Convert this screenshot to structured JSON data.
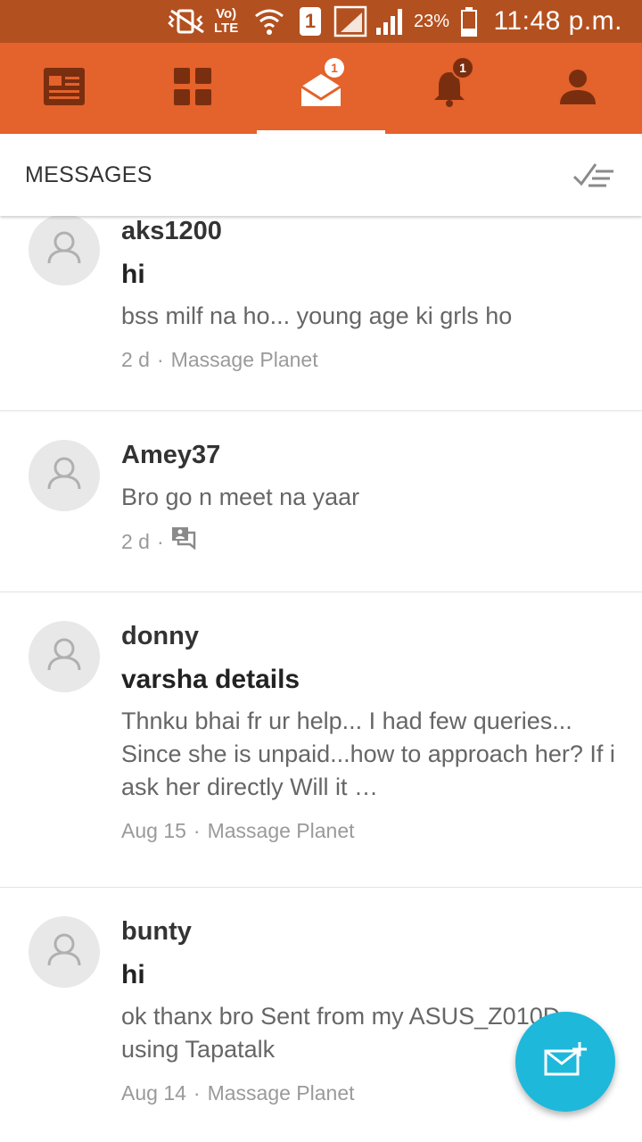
{
  "status_bar": {
    "network_label_top": "Vo)",
    "network_label_bottom": "LTE",
    "sim_slot": "1",
    "battery_percent": "23%",
    "time": "11:48 p.m.",
    "icons": [
      "vibrate-icon",
      "volte-icon",
      "wifi-icon",
      "sim-icon",
      "signal-icon",
      "signal-icon",
      "battery-icon"
    ]
  },
  "nav": {
    "tabs": [
      {
        "name": "topics",
        "icon": "newspaper-icon"
      },
      {
        "name": "forums",
        "icon": "grid-icon"
      },
      {
        "name": "messages",
        "icon": "mail-icon",
        "badge": "1",
        "active": true
      },
      {
        "name": "notifications",
        "icon": "bell-icon",
        "badge": "1"
      },
      {
        "name": "profile",
        "icon": "person-icon"
      }
    ],
    "colors": {
      "bar": "#e4622b",
      "icon": "#7a2e10",
      "badge_fill": "#7a2e10"
    }
  },
  "header": {
    "title": "MESSAGES",
    "action_icon": "mark-all-read-icon"
  },
  "messages": [
    {
      "username": "aks1200",
      "subject": "hi",
      "preview": "bss milf na ho... young age ki grls ho",
      "time": "2 d",
      "forum": "Massage Planet"
    },
    {
      "username": "Amey37",
      "subject": "",
      "preview": "Bro go n meet na yaar",
      "time": "2 d",
      "forum": "",
      "meta_icon": "conversation-icon"
    },
    {
      "username": "donny",
      "subject": "varsha details",
      "preview": "Thnku bhai fr ur help... I had few queries... Since she is unpaid...how to approach her? If i ask her directly Will it …",
      "time": "Aug 15",
      "forum": "Massage Planet"
    },
    {
      "username": "bunty",
      "subject": "hi",
      "preview": "ok thanx bro Sent from my ASUS_Z010D using Tapatalk",
      "time": "Aug 14",
      "forum": "Massage Planet"
    }
  ],
  "meta_separator": "·",
  "fab": {
    "icon": "compose-mail-icon",
    "color": "#1eb8db"
  }
}
